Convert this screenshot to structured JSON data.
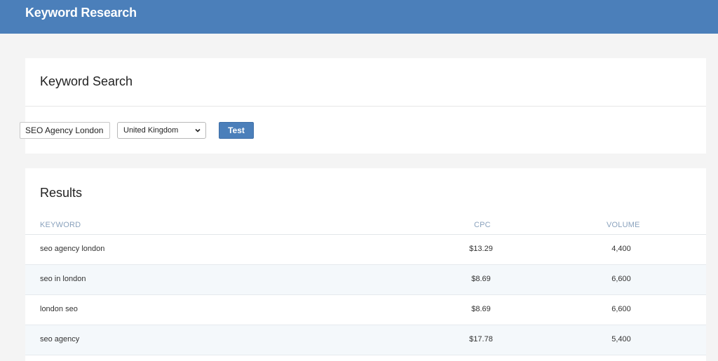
{
  "app": {
    "title": "Keyword Research"
  },
  "search": {
    "title": "Keyword Search",
    "keyword_value": "SEO Agency London",
    "country_selected": "United Kingdom",
    "button_label": "Test"
  },
  "results": {
    "title": "Results",
    "columns": {
      "keyword": "KEYWORD",
      "cpc": "CPC",
      "volume": "VOLUME"
    },
    "rows": [
      {
        "keyword": "seo agency london",
        "cpc": "$13.29",
        "volume": "4,400"
      },
      {
        "keyword": "seo in london",
        "cpc": "$8.69",
        "volume": "6,600"
      },
      {
        "keyword": "london seo",
        "cpc": "$8.69",
        "volume": "6,600"
      },
      {
        "keyword": "seo agency",
        "cpc": "$17.78",
        "volume": "5,400"
      }
    ]
  },
  "colors": {
    "accent": "#4b7fba",
    "header_text": "#8aa2bd",
    "alt_row": "#f4f8fb"
  }
}
